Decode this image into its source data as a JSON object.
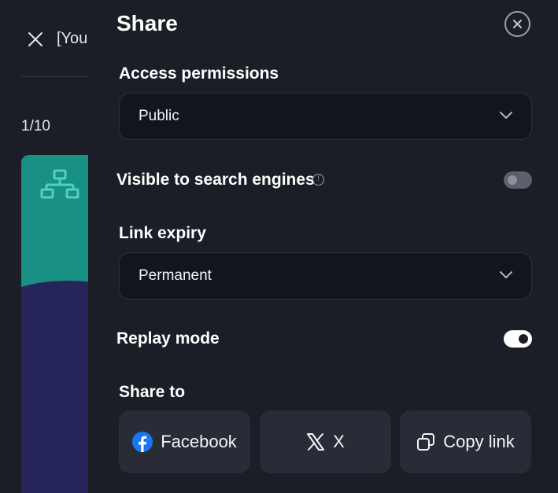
{
  "background": {
    "title": "[You",
    "counter": "1/10"
  },
  "panel": {
    "title": "Share",
    "access": {
      "label": "Access permissions",
      "value": "Public"
    },
    "search_engines": {
      "label": "Visible to search engines",
      "enabled": false
    },
    "expiry": {
      "label": "Link expiry",
      "value": "Permanent"
    },
    "replay": {
      "label": "Replay mode",
      "enabled": true
    },
    "share_to": {
      "label": "Share to",
      "buttons": [
        {
          "label": "Facebook",
          "icon": "facebook-icon"
        },
        {
          "label": "X",
          "icon": "x-logo-icon"
        },
        {
          "label": "Copy link",
          "icon": "copy-icon"
        }
      ]
    }
  },
  "colors": {
    "background": "#1b1e26",
    "select_bg": "#12151c",
    "button_bg": "#272c36",
    "facebook_blue": "#1877f2",
    "slide_teal": "#1a8f84",
    "slide_navy": "#25255a"
  }
}
